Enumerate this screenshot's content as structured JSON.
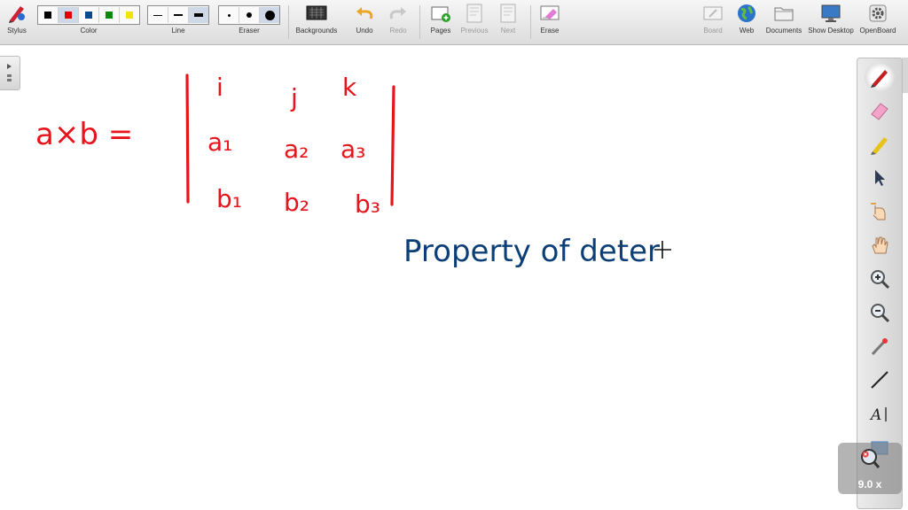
{
  "toolbar": {
    "stylus": "Stylus",
    "color": "Color",
    "line": "Line",
    "eraser": "Eraser",
    "backgrounds": "Backgrounds",
    "undo": "Undo",
    "redo": "Redo",
    "pages": "Pages",
    "previous": "Previous",
    "next": "Next",
    "erase": "Erase",
    "board": "Board",
    "web": "Web",
    "documents": "Documents",
    "show_desktop": "Show Desktop",
    "openboard": "OpenBoard"
  },
  "colors": {
    "swatches": [
      "#000000",
      "#e00000",
      "#0b4a8c",
      "#0a8a0a",
      "#f5e400"
    ],
    "ink_red": "#e8141c",
    "ink_blue": "#0c3f78"
  },
  "side_tools": [
    "pen-icon",
    "eraser-icon",
    "marker-icon",
    "selector-icon",
    "interact-icon",
    "hand-icon",
    "zoom-in-icon",
    "zoom-out-icon",
    "laser-pointer-icon",
    "line-icon",
    "text-icon",
    "capture-icon"
  ],
  "zoom_label": "9.0 x",
  "board": {
    "formula_left": "a×b =",
    "matrix": [
      [
        "i",
        "j",
        "k"
      ],
      [
        "a₁",
        "a₂",
        "a₃"
      ],
      [
        "b₁",
        "b₂",
        "b₃"
      ]
    ],
    "note": "Property of deter"
  }
}
